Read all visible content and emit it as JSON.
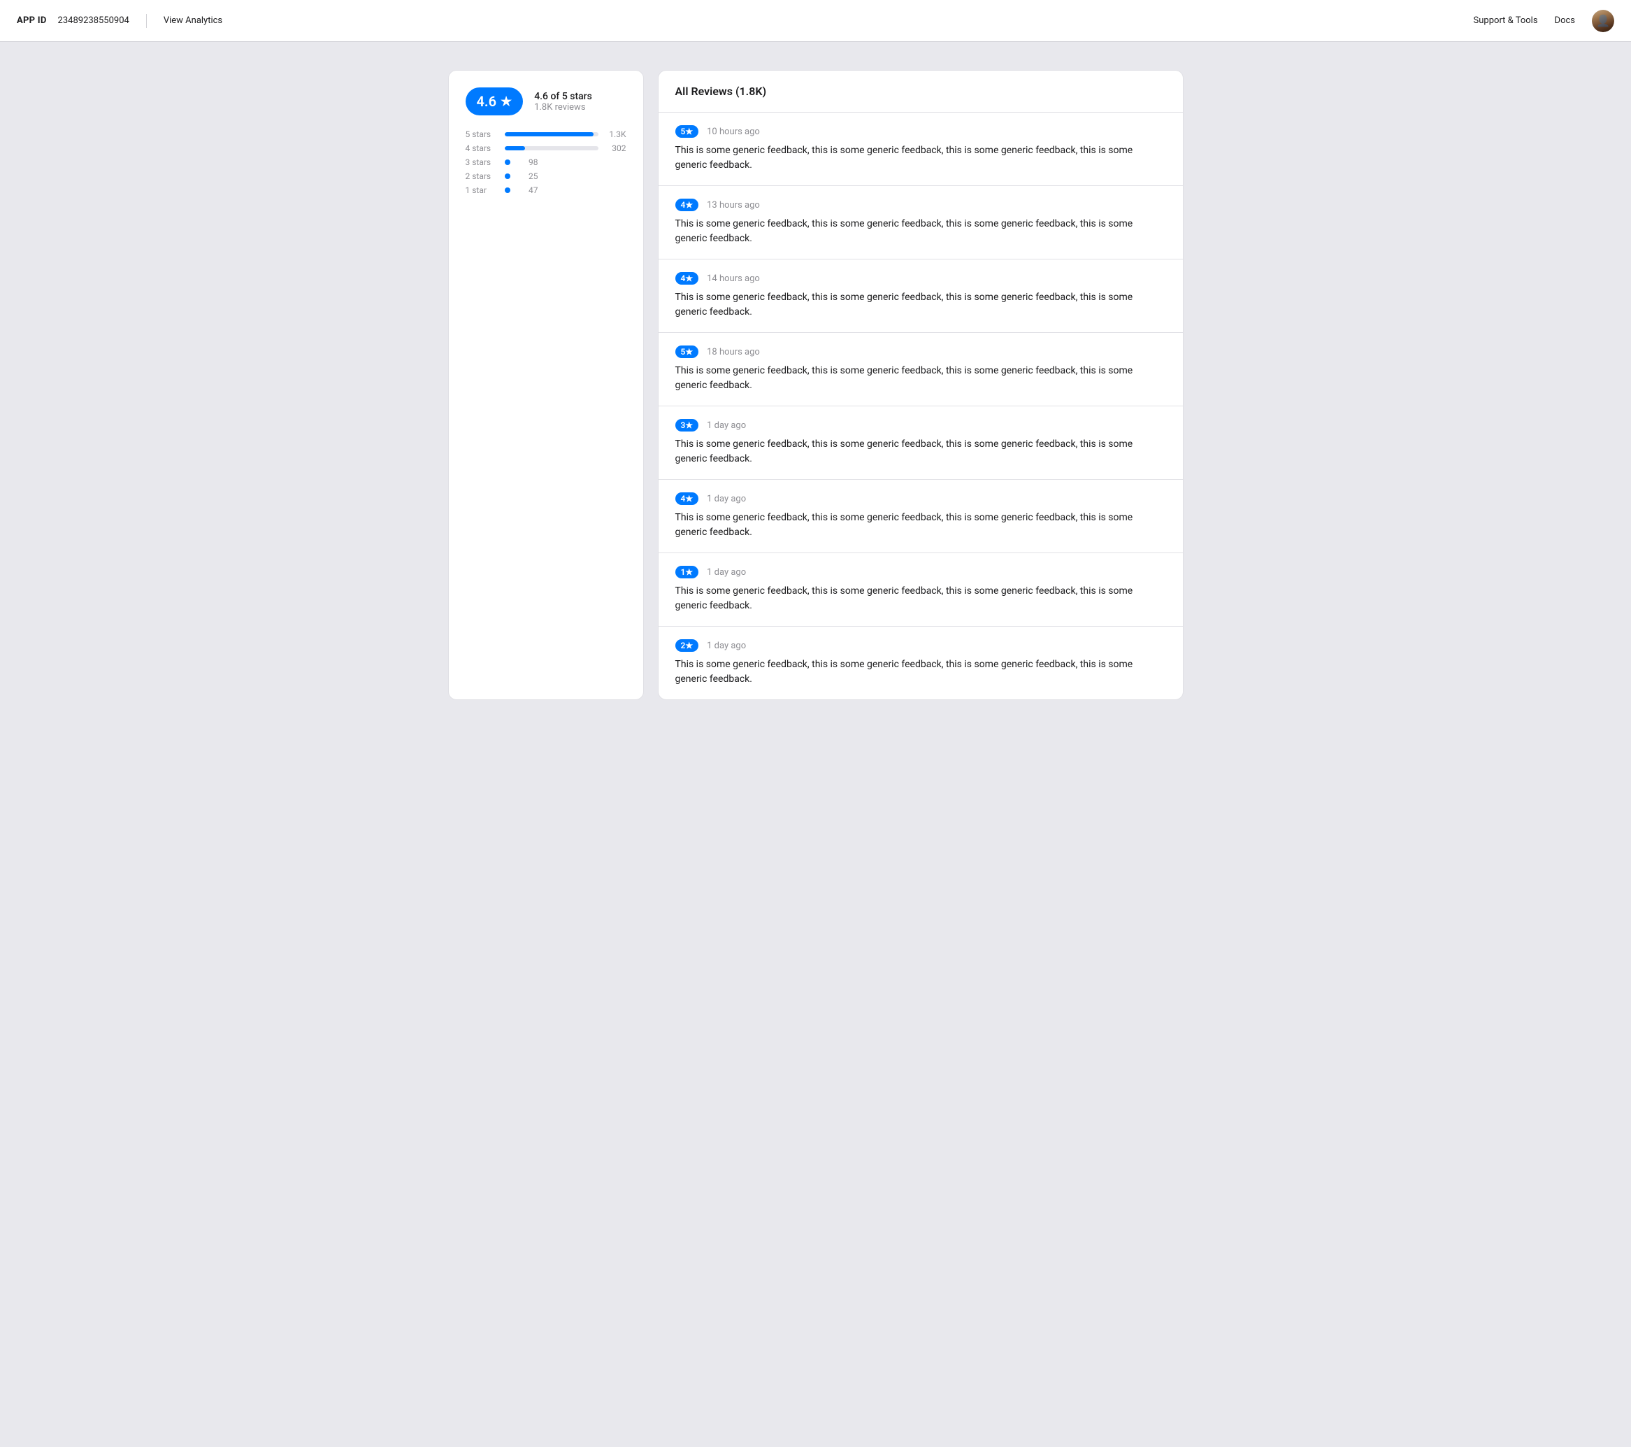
{
  "header": {
    "app_id_label": "APP ID",
    "app_id_value": "23489238550904",
    "view_analytics": "View Analytics",
    "support_tools": "Support & Tools",
    "docs": "Docs"
  },
  "rating_card": {
    "score": "4.6",
    "star_symbol": "★",
    "of_stars": "4.6 of 5 stars",
    "total_reviews": "1.8K reviews",
    "bars": [
      {
        "label": "5 stars",
        "width_pct": 95,
        "count": "1.3K",
        "has_bar": true
      },
      {
        "label": "4 stars",
        "width_pct": 22,
        "count": "302",
        "has_bar": true
      },
      {
        "label": "3 stars",
        "width_pct": 0,
        "count": "98",
        "has_bar": false
      },
      {
        "label": "2 stars",
        "width_pct": 0,
        "count": "25",
        "has_bar": false
      },
      {
        "label": "1 star",
        "width_pct": 0,
        "count": "47",
        "has_bar": false
      }
    ]
  },
  "reviews": {
    "title": "All Reviews (1.8K)",
    "items": [
      {
        "stars": "5★",
        "time": "10 hours ago",
        "text": "This is some generic feedback, this is some generic feedback, this is some generic feedback, this is some generic feedback."
      },
      {
        "stars": "4★",
        "time": "13 hours ago",
        "text": "This is some generic feedback, this is some generic feedback, this is some generic feedback, this is some generic feedback."
      },
      {
        "stars": "4★",
        "time": "14 hours ago",
        "text": "This is some generic feedback, this is some generic feedback, this is some generic feedback, this is some generic feedback."
      },
      {
        "stars": "5★",
        "time": "18 hours ago",
        "text": "This is some generic feedback, this is some generic feedback, this is some generic feedback, this is some generic feedback."
      },
      {
        "stars": "3★",
        "time": "1 day ago",
        "text": "This is some generic feedback, this is some generic feedback, this is some generic feedback, this is some generic feedback."
      },
      {
        "stars": "4★",
        "time": "1 day ago",
        "text": "This is some generic feedback, this is some generic feedback, this is some generic feedback, this is some generic feedback."
      },
      {
        "stars": "1★",
        "time": "1 day ago",
        "text": "This is some generic feedback, this is some generic feedback, this is some generic feedback, this is some generic feedback."
      },
      {
        "stars": "2★",
        "time": "1 day ago",
        "text": "This is some generic feedback, this is some generic feedback, this is some generic feedback, this is some generic feedback."
      }
    ]
  }
}
